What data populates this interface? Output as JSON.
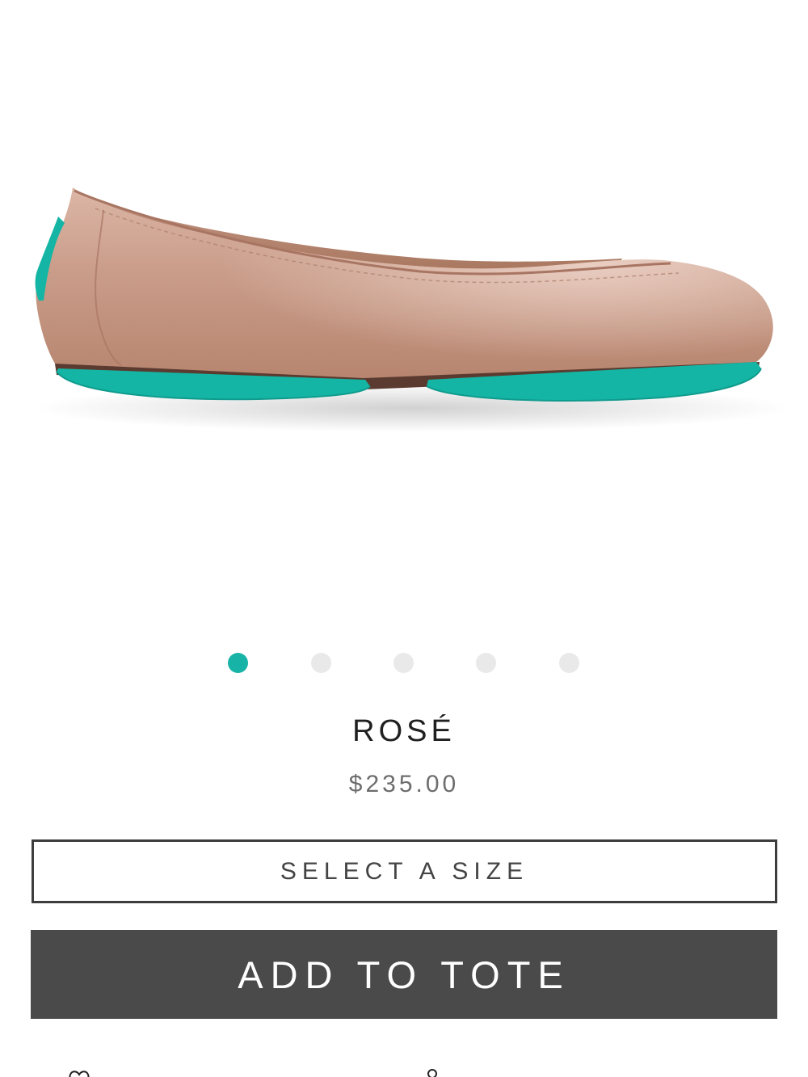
{
  "product": {
    "name": "ROSÉ",
    "price": "$235.00"
  },
  "carousel": {
    "count": 5,
    "active_index": 0,
    "active_color": "#17b3a6",
    "inactive_color": "#e9e9e9"
  },
  "size_selector": {
    "label": "SELECT A SIZE"
  },
  "add_to_tote": {
    "label": "ADD TO TOTE",
    "background": "#4a4a4a"
  },
  "colors": {
    "shoe_leather": "#c79a88",
    "sole_accent": "#14b5a4"
  },
  "icons": {
    "image": "product-image-rose-ballet-flat",
    "bottom_left": "heart-icon",
    "bottom_center": "share-icon"
  }
}
